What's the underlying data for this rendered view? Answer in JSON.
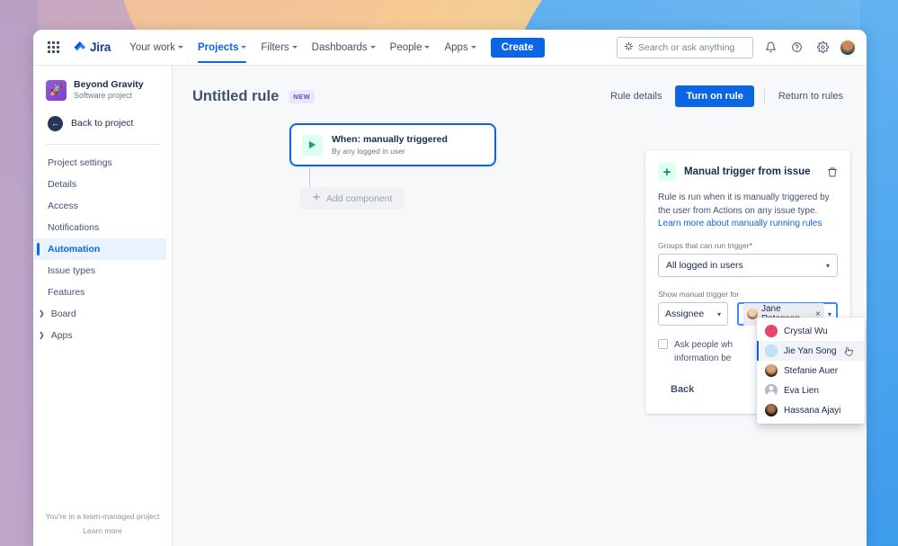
{
  "topnav": {
    "app_switcher": "app-switcher",
    "logo_text": "Jira",
    "links": [
      {
        "label": "Your work",
        "has_chevron": true,
        "active": false
      },
      {
        "label": "Projects",
        "has_chevron": true,
        "active": true
      },
      {
        "label": "Filters",
        "has_chevron": true,
        "active": false
      },
      {
        "label": "Dashboards",
        "has_chevron": true,
        "active": false
      },
      {
        "label": "People",
        "has_chevron": true,
        "active": false
      },
      {
        "label": "Apps",
        "has_chevron": true,
        "active": false
      }
    ],
    "create_label": "Create",
    "search_placeholder": "Search or ask anything",
    "icons": [
      "sparkle-search-icon",
      "notifications-bell-icon",
      "help-question-icon",
      "settings-gear-icon",
      "user-avatar"
    ]
  },
  "sidebar": {
    "project_name": "Beyond Gravity",
    "project_type": "Software project",
    "project_avatar_glyph": "🚀",
    "back_label": "Back to project",
    "items": [
      {
        "label": "Project settings",
        "active": false,
        "expandable": false
      },
      {
        "label": "Details",
        "active": false,
        "expandable": false
      },
      {
        "label": "Access",
        "active": false,
        "expandable": false
      },
      {
        "label": "Notifications",
        "active": false,
        "expandable": false
      },
      {
        "label": "Automation",
        "active": true,
        "expandable": false
      },
      {
        "label": "Issue types",
        "active": false,
        "expandable": false
      },
      {
        "label": "Features",
        "active": false,
        "expandable": false
      },
      {
        "label": "Board",
        "active": false,
        "expandable": true
      },
      {
        "label": "Apps",
        "active": false,
        "expandable": true
      }
    ],
    "footer_line1": "You're in a team-managed project",
    "footer_line2": "Learn more"
  },
  "main": {
    "rule_title": "Untitled rule",
    "badge": "NEW",
    "actions": {
      "rule_details": "Rule details",
      "turn_on_rule": "Turn on rule",
      "return_to_rules": "Return to rules"
    },
    "trigger_card": {
      "title": "When: manually triggered",
      "subtitle": "By any logged in user",
      "icon": "play-icon"
    },
    "add_component": "Add component"
  },
  "panel": {
    "title": "Manual trigger from issue",
    "add_icon": "plus-icon",
    "delete_icon": "trash-icon",
    "description": "Rule is run when it is manually triggered by the user from Actions on any issue type.",
    "learn_more": "Learn more about manually running rules",
    "groups_label": "Groups that can run trigger",
    "groups_required": "*",
    "groups_value": "All logged in users",
    "show_trigger_label": "Show manual trigger for",
    "field_type_value": "Assignee",
    "chip_name": "Jane Rotanson",
    "chip_remove": "×",
    "checkbox_text_line1": "Ask people wh",
    "checkbox_text_line2": "information be",
    "back_label": "Back"
  },
  "people_dropdown": {
    "options": [
      {
        "name": "Crystal Wu",
        "avatar": "av-crystal",
        "hovered": false
      },
      {
        "name": "Jie Yan Song",
        "avatar": "av-jie",
        "hovered": true
      },
      {
        "name": "Stefanie Auer",
        "avatar": "av-stef",
        "hovered": false
      },
      {
        "name": "Eva Lien",
        "avatar": "av-eva",
        "hovered": false
      },
      {
        "name": "Hassana Ajayi",
        "avatar": "av-hass",
        "hovered": false
      }
    ]
  },
  "colors": {
    "brand_blue": "#0c66e4",
    "focus_blue": "#388bff",
    "text_dark": "#172b4d",
    "text_sub": "#42526e",
    "muted": "#6b778c",
    "badge_purple_bg": "#eae6ff",
    "badge_purple_fg": "#5e4db2",
    "green_bg": "#dcfff1",
    "green_fg": "#1f845a",
    "required_red": "#de350b"
  }
}
